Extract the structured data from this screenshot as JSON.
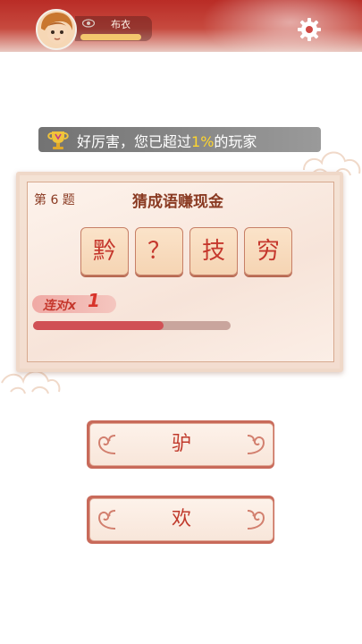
{
  "header": {
    "player_name": "布衣",
    "avatar_icon": "avatar-portrait",
    "rank_icon": "eye-badge-icon",
    "settings_icon": "gear-icon"
  },
  "tip": {
    "prefix": "好厉害，您已超过",
    "highlight": "1%",
    "suffix": "的玩家",
    "icon": "trophy-icon"
  },
  "puzzle": {
    "question_number": "第 6 题",
    "title": "猜成语赚现金",
    "tiles": [
      "黔",
      "？",
      "技",
      "穷"
    ],
    "streak_label": "连对x",
    "streak_count": "1",
    "progress": 0.66
  },
  "answers": [
    {
      "label": "驴"
    },
    {
      "label": "欢"
    }
  ],
  "colors": {
    "header_red": "#b92c26",
    "tile_text": "#c5372c",
    "highlight": "#ffd62e",
    "progress_fill": "#d05055"
  }
}
